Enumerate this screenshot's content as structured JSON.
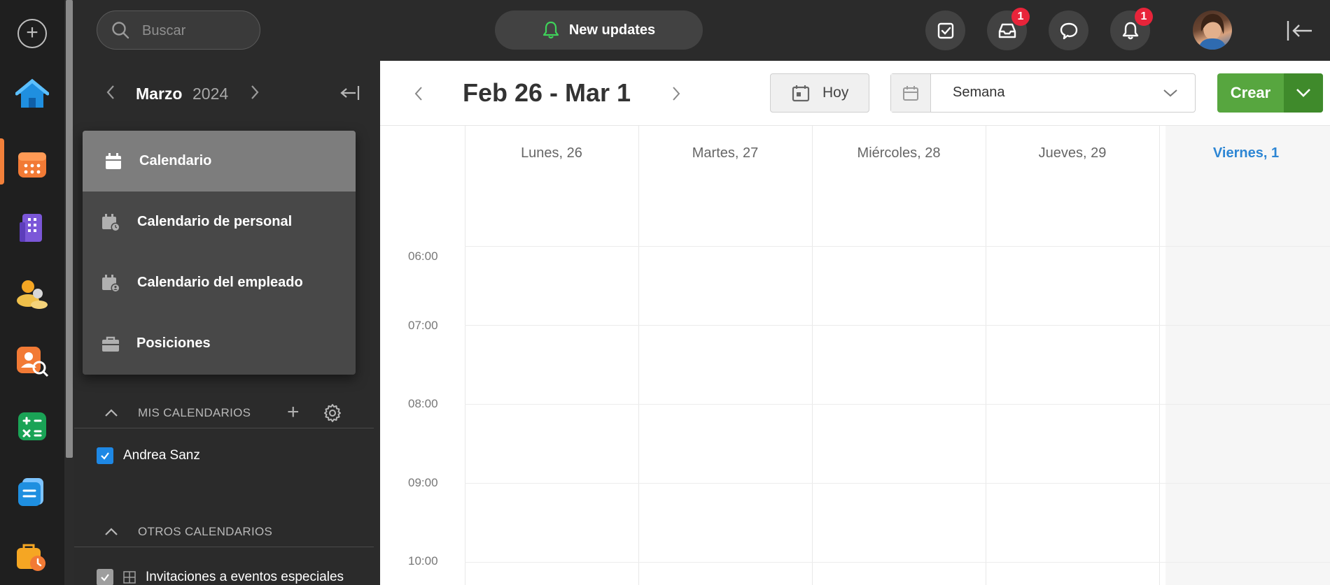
{
  "topbar": {
    "search_placeholder": "Buscar",
    "updates_label": "New updates",
    "badges": {
      "inbox": "1",
      "notifications": "1"
    }
  },
  "sidebar": {
    "month": "Marzo",
    "year": "2024",
    "menu": [
      {
        "label": "Calendario",
        "icon": "calendar-icon",
        "selected": true
      },
      {
        "label": "Calendario de personal",
        "icon": "calendar-clock-icon"
      },
      {
        "label": "Calendario del empleado",
        "icon": "calendar-person-icon"
      },
      {
        "label": "Posiciones",
        "icon": "briefcase-icon"
      }
    ],
    "my_calendars": {
      "title": "MIS CALENDARIOS",
      "items": [
        {
          "label": "Andrea Sanz",
          "checked": true,
          "color": "#1e88e5"
        }
      ]
    },
    "other_calendars": {
      "title": "OTROS CALENDARIOS",
      "items": [
        {
          "label": "Invitaciones a eventos especiales",
          "checked": true,
          "color": "#9e9e9e"
        }
      ]
    }
  },
  "calendar": {
    "range_title": "Feb 26 - Mar 1",
    "today_label": "Hoy",
    "view_label": "Semana",
    "create_label": "Crear",
    "days": [
      {
        "label": "Lunes, 26"
      },
      {
        "label": "Martes, 27"
      },
      {
        "label": "Miércoles, 28"
      },
      {
        "label": "Jueves, 29"
      },
      {
        "label": "Viernes, 1",
        "today": true
      }
    ],
    "hours": [
      "06:00",
      "07:00",
      "08:00",
      "09:00",
      "10:00"
    ]
  },
  "colors": {
    "accent_green": "#57a63f",
    "today_blue": "#2d86d4",
    "badge_red": "#e8243a",
    "bell_green": "#3fd35a"
  }
}
